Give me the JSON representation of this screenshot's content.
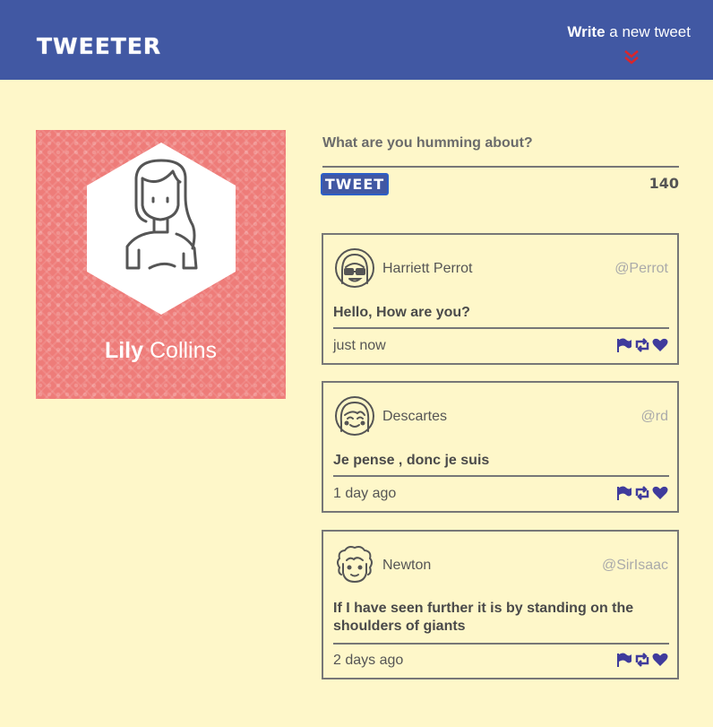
{
  "header": {
    "logo": "TWEETER",
    "write_bold": "Write",
    "write_rest": " a new tweet",
    "chevron_icon": "double-chevron-down-icon",
    "chevron_color": "#d9262b",
    "background": "#4158a3"
  },
  "profile": {
    "first_name": "Lily",
    "last_name": " Collins",
    "card_color": "#ee7c79"
  },
  "compose": {
    "prompt": "What are you humming about?",
    "button_label": "TWEET",
    "remaining": "140"
  },
  "tweets": [
    {
      "author": "Harriett Perrot",
      "handle": "@Perrot",
      "text": "Hello, How are you?",
      "time": "just now",
      "avatar": "woman-with-glasses-avatar"
    },
    {
      "author": "Descartes",
      "handle": "@rd",
      "text": "Je pense , donc je suis",
      "time": "1 day ago",
      "avatar": "smiling-person-avatar"
    },
    {
      "author": "Newton",
      "handle": "@SirIsaac",
      "text": "If I have seen further it is by standing on the shoulders of giants",
      "time": "2 days ago",
      "avatar": "curly-haired-man-avatar"
    }
  ],
  "action_icons": [
    "flag-icon",
    "retweet-icon",
    "heart-icon"
  ],
  "action_color": "#3f3b9c",
  "page_background": "#fef7c9"
}
